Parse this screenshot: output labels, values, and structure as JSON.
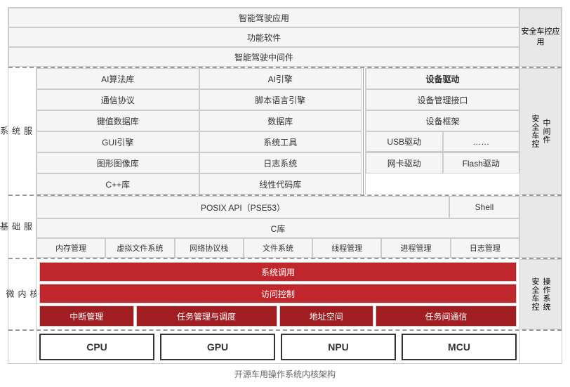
{
  "diagram": {
    "title": "开源车用操作系统内核架构",
    "top": {
      "rows": [
        {
          "label": "智能驾驶应用"
        },
        {
          "label": "功能软件"
        },
        {
          "label": "智能驾驶中间件"
        }
      ],
      "right_label": "安全车控应用"
    },
    "sys": {
      "label": "系\n统\n服\n务",
      "left_grid": [
        [
          "AI算法库",
          "AI引擎"
        ],
        [
          "通信协议",
          "脚本语言引擎"
        ],
        [
          "键值数据库",
          "数据库"
        ],
        [
          "GUI引擎",
          "系统工具"
        ],
        [
          "图形图像库",
          "日志系统"
        ],
        [
          "C++库",
          "线性代码库"
        ]
      ],
      "right_block": {
        "title": "设备驱动",
        "items": [
          {
            "full": "设备管理接口"
          },
          {
            "full": "设备框架"
          },
          {
            "left": "USB驱动",
            "right": "……"
          },
          {
            "left": "网卡驱动",
            "right": "Flash驱动"
          }
        ]
      },
      "right_label": "安全车控\n中间件"
    },
    "basic": {
      "label": "基\n础\n服\n务",
      "rows": [
        {
          "type": "full",
          "label": "POSIX API（PSE53）",
          "right": "Shell"
        },
        {
          "type": "full",
          "label": "C库"
        },
        {
          "type": "multi",
          "cells": [
            "内存管理",
            "虚拟文件系统",
            "网络协议栈",
            "文件系统",
            "线程管理",
            "进程管理",
            "日志管理"
          ]
        }
      ]
    },
    "kernel": {
      "label": "微\n内\n核",
      "rows": [
        {
          "label": "系统调用"
        },
        {
          "label": "访问控制"
        },
        {
          "cells": [
            "中断管理",
            "任务管理与调度",
            "地址空间",
            "任务间通信"
          ]
        }
      ],
      "right_label": "安全车控\n操作系统"
    },
    "bottom": {
      "cells": [
        "CPU",
        "GPU",
        "NPU",
        "MCU"
      ]
    }
  }
}
